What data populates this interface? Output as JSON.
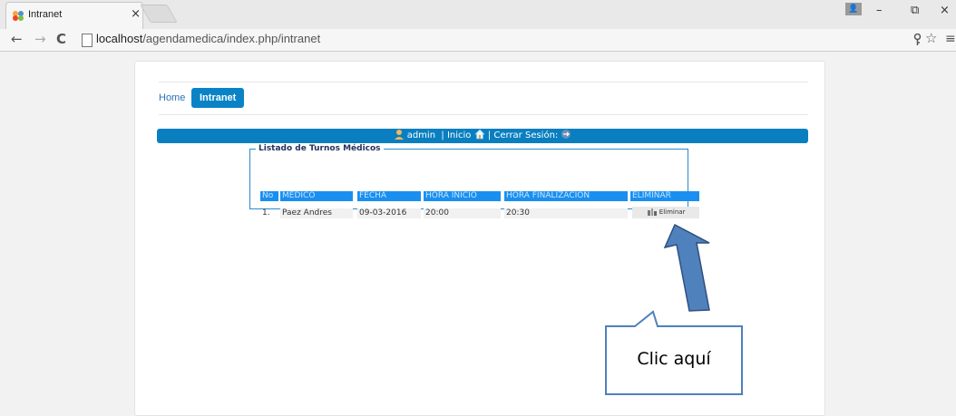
{
  "browser": {
    "tab_title": "Intranet",
    "tab_close": "×",
    "url_host": "localhost",
    "url_path": "/agendamedica/index.php/intranet",
    "back": "←",
    "forward": "→",
    "reload": "C",
    "win_minimize": "–",
    "win_restore": "⧉",
    "win_close": "×",
    "key_icon": "key-icon",
    "star": "☆",
    "menu": "≡"
  },
  "nav": {
    "home": "Home",
    "intranet": "Intranet"
  },
  "userbar": {
    "user": "admin",
    "sep1": "|",
    "inicio": "Inicio",
    "sep2": "|",
    "cerrar": "Cerrar Sesión:"
  },
  "table": {
    "legend": "Listado de Turnos Médicos",
    "headers": [
      "No",
      "MEDICO",
      "FECHA",
      "HORA INICIO",
      "HORA FINALIZACION",
      "ELIMINAR"
    ],
    "rows": [
      {
        "no": "1.",
        "medico": "Paez Andres",
        "fecha": "09-03-2016",
        "inicio": "20:00",
        "fin": "20:30",
        "eliminar": "Eliminar"
      }
    ]
  },
  "callout": {
    "text": "Clic aquí"
  },
  "colors": {
    "accent": "#0a83c6",
    "header_cell": "#1a8ff0",
    "arrow": "#4f81bd"
  }
}
